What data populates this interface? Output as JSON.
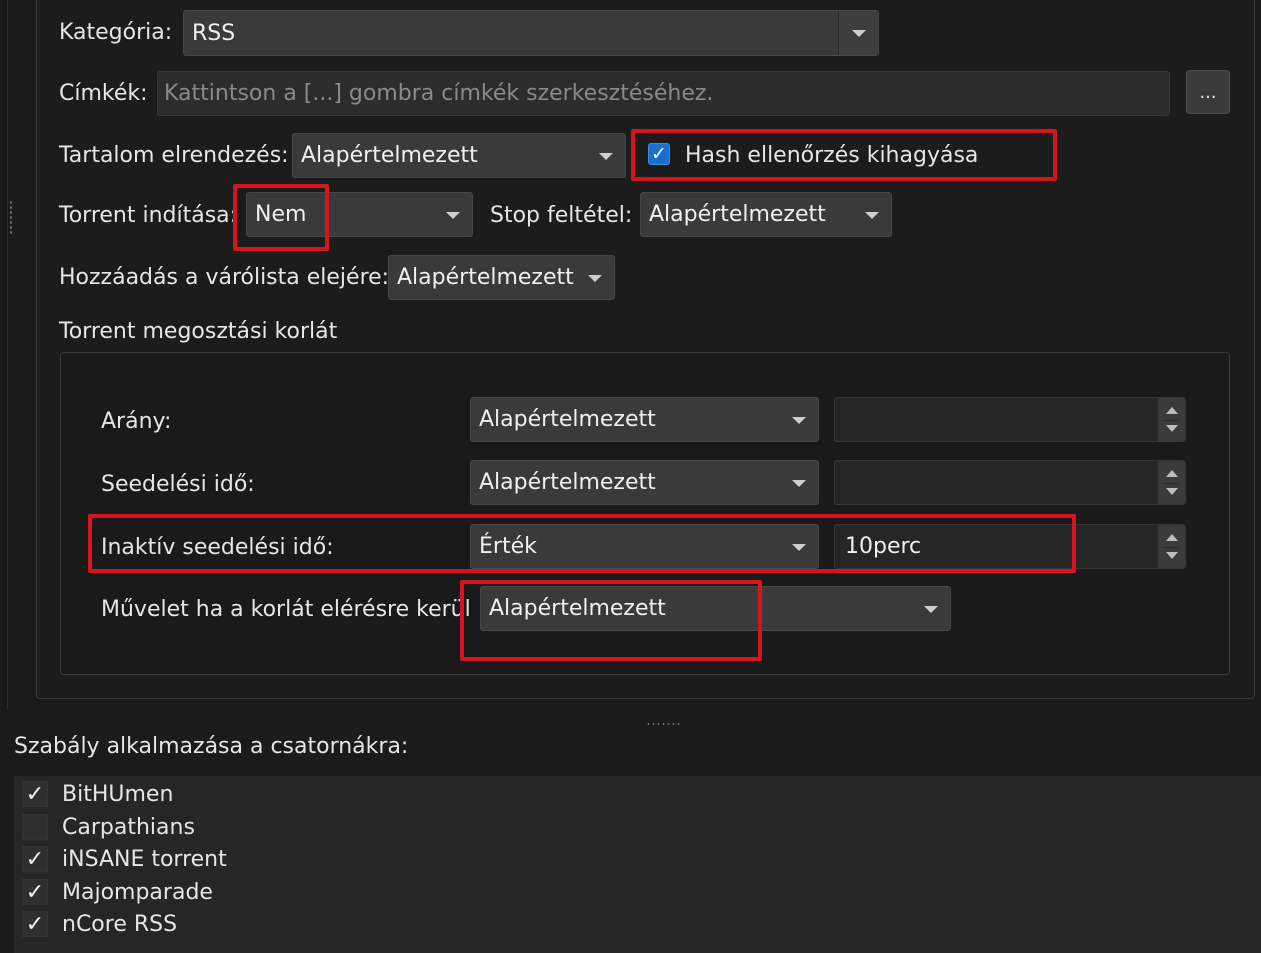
{
  "category": {
    "label": "Kategória:",
    "value": "RSS"
  },
  "tags": {
    "label": "Címkék:",
    "placeholder": "Kattintson a [...] gombra címkék szerkesztéséhez.",
    "button": "..."
  },
  "layout": {
    "label": "Tartalom elrendezés:",
    "value": "Alapértelmezett"
  },
  "skip_hash": {
    "label": "Hash ellenőrzés kihagyása",
    "checked": true,
    "check_glyph": "✓"
  },
  "start_torrent": {
    "label": "Torrent indítása:",
    "value": "Nem"
  },
  "stop_condition": {
    "label": "Stop feltétel:",
    "value": "Alapértelmezett"
  },
  "add_to_top": {
    "label": "Hozzáadás a várólista elejére:",
    "value": "Alapértelmezett"
  },
  "share_limits": {
    "title": "Torrent megosztási korlát",
    "ratio": {
      "label": "Arány:",
      "mode": "Alapértelmezett",
      "value": ""
    },
    "seeding_time": {
      "label": "Seedelési idő:",
      "mode": "Alapértelmezett",
      "value": ""
    },
    "inactive_seeding_time": {
      "label": "Inaktív seedelési idő:",
      "mode": "Érték",
      "value": "10perc"
    },
    "action": {
      "label": "Művelet ha a korlát elérésre kerül",
      "value": "Alapértelmezett"
    }
  },
  "feeds": {
    "label": "Szabály alkalmazása a csatornákra:",
    "items": [
      {
        "name": "BitHUmen",
        "mark": "✓"
      },
      {
        "name": "Carpathians",
        "mark": ""
      },
      {
        "name": "iNSANE torrent",
        "mark": "✓"
      },
      {
        "name": "Majomparade",
        "mark": "✓"
      },
      {
        "name": "nCore RSS",
        "mark": "✓"
      }
    ]
  },
  "colors": {
    "highlight": "#d5141e",
    "accent": "#1a6fd0"
  }
}
